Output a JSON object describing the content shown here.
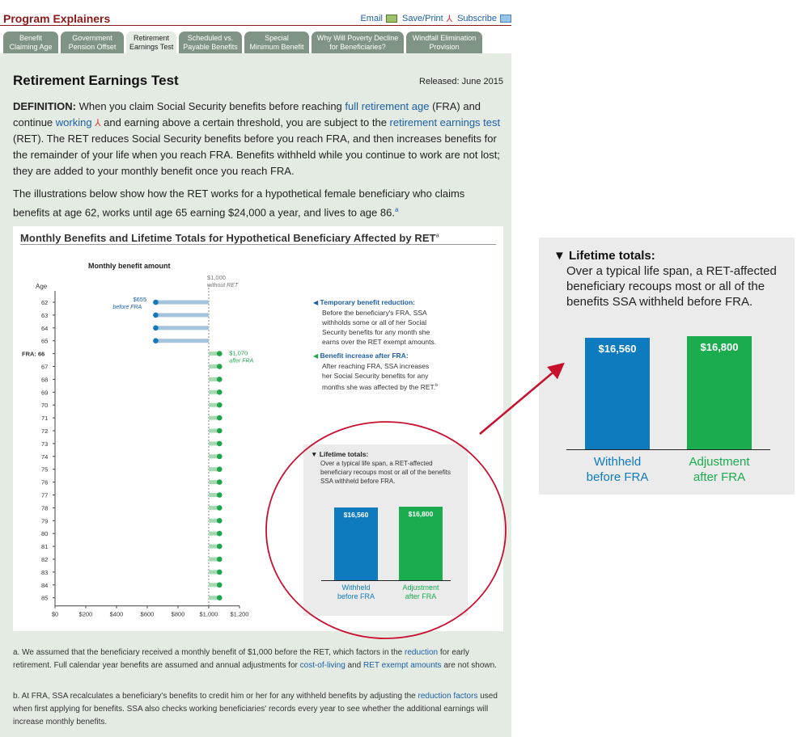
{
  "header": {
    "title": "Program Explainers",
    "email_label": "Email",
    "saveprint_label": "Save/Print",
    "subscribe_label": "Subscribe"
  },
  "tabs": [
    {
      "line1": "Benefit",
      "line2": "Claiming Age",
      "active": false
    },
    {
      "line1": "Government",
      "line2": "Pension Offset",
      "active": false
    },
    {
      "line1": "Retirement",
      "line2": "Earnings Test",
      "active": true
    },
    {
      "line1": "Scheduled vs.",
      "line2": "Payable Benefits",
      "active": false
    },
    {
      "line1": "Special",
      "line2": "Minimum Benefit",
      "active": false
    },
    {
      "line1": "Why Will Poverty Decline",
      "line2": "for Beneficiaries?",
      "active": false
    },
    {
      "line1": "Windfall Elimination",
      "line2": "Provision",
      "active": false
    }
  ],
  "page": {
    "title": "Retirement Earnings Test",
    "released": "Released: June 2015",
    "definition": {
      "lead": "DEFINITION:",
      "t1": " When you claim Social Security benefits before reaching ",
      "link_fra": "full retirement age",
      "t2": " (FRA) and continue ",
      "link_working": "working",
      "t3": " and earning above a certain threshold, you are subject to the ",
      "link_ret": "retirement earnings test",
      "t4": " (RET). The RET reduces Social Security benefits before you reach FRA, and then increases benefits for the remainder of your life when you reach FRA. Benefits withheld while you continue to work are not lost; they are added to your monthly benefit once you reach FRA."
    },
    "illustration": {
      "text": "The illustrations below show how the RET works for a hypothetical female beneficiary who claims benefits at age 62, works until age 65 earning $24,000 a year, and lives to age 86.",
      "sup": "a"
    }
  },
  "chart_data": [
    {
      "type": "bar",
      "orientation": "horizontal",
      "title": "Monthly Benefits and Lifetime Totals for Hypothetical Beneficiary Affected by RET",
      "title_sup": "a",
      "subtitle": "Monthly benefit amount",
      "ylabel": "Age",
      "fra_label": "FRA: 66",
      "categories": [
        "62",
        "63",
        "64",
        "65",
        "66",
        "67",
        "68",
        "69",
        "70",
        "71",
        "72",
        "73",
        "74",
        "75",
        "76",
        "77",
        "78",
        "79",
        "80",
        "81",
        "82",
        "83",
        "84",
        "85"
      ],
      "series": [
        {
          "values": [
            655,
            655,
            655,
            655,
            1070,
            1070,
            1070,
            1070,
            1070,
            1070,
            1070,
            1070,
            1070,
            1070,
            1070,
            1070,
            1070,
            1070,
            1070,
            1070,
            1070,
            1070,
            1070,
            1070
          ]
        }
      ],
      "reference_line": {
        "value": 1000,
        "label": "$1,000",
        "sublabel": "without RET"
      },
      "xlim": [
        0,
        1200
      ],
      "xticks": [
        "$0",
        "$200",
        "$400",
        "$600",
        "$800",
        "$1,000",
        "$1,200"
      ],
      "point_labels": [
        {
          "value": "$655",
          "note": "before FRA"
        },
        {
          "value": "$1,070",
          "note": "after FRA"
        }
      ],
      "colors": {
        "reduced": "#1379b8",
        "reduced_bar": "#a6c3dc",
        "increased": "#1fa64b",
        "increased_bar": "#a7d8b2",
        "ref_line": "#888888"
      },
      "annotations": [
        {
          "heading": "Temporary benefit reduction:",
          "text": [
            "Before the beneficiary's FRA, SSA",
            "withholds some or all of her Social",
            "Security benefits for any month she",
            "earns over the RET exempt amounts."
          ]
        },
        {
          "heading": "Benefit increase after FRA:",
          "text": [
            "After reaching FRA, SSA increases",
            "her Social Security benefits for any",
            "months she was affected by the RET."
          ],
          "sup": "b"
        }
      ]
    },
    {
      "type": "bar",
      "title": "Lifetime totals:",
      "description": "Over a typical life span, a RET-affected beneficiary recoups most or all of the benefits SSA withheld before FRA.",
      "categories": [
        "Withheld before FRA",
        "Adjustment after FRA"
      ],
      "category_lines": [
        [
          "Withheld",
          "before FRA"
        ],
        [
          "Adjustment",
          "after FRA"
        ]
      ],
      "values": [
        16560,
        16800
      ],
      "value_labels": [
        "$16,560",
        "$16,800"
      ],
      "colors": [
        "#0f7bbf",
        "#1aac4f"
      ]
    }
  ],
  "footnotes": {
    "a": {
      "t1": "a. We assumed that the beneficiary received a monthly benefit of $1,000 before the RET, which factors in the ",
      "link1": "reduction",
      "t2": " for early retirement. Full calendar year benefits are assumed and annual adjustments for ",
      "link2": "cost-of-living",
      "t3": " and ",
      "link3": "RET exempt amounts",
      "t4": " are not shown."
    },
    "b": {
      "t1": "b. At FRA, SSA recalculates a beneficiary's benefits to credit him or her for any withheld benefits by adjusting the ",
      "link1": "reduction factors",
      "t2": " used when first applying for benefits. SSA also checks working beneficiaries' records every year to see whether the additional earnings will increase monthly benefits."
    }
  },
  "callout": {
    "color": "#c8102e"
  }
}
